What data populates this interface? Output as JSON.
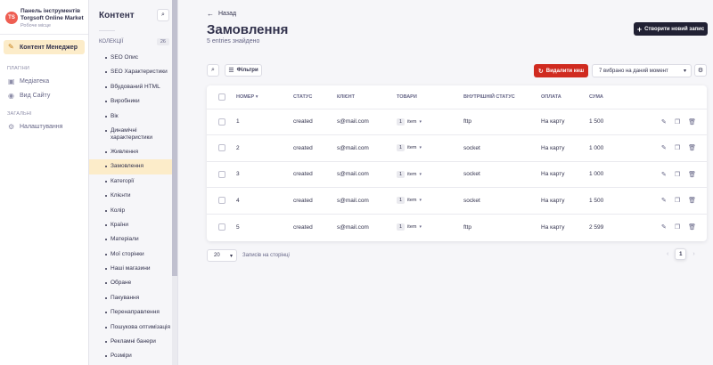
{
  "brand": {
    "title_line1": "Панель інструментів",
    "title_line2": "Torgsoft Online Market",
    "subtitle": "Робоче місце",
    "logo_text": "TS"
  },
  "mainnav": {
    "active_item": "Контент Менеджер",
    "plugins_label": "ПЛАГІНИ",
    "plugins": [
      "Медіатека",
      "Вид Сайту"
    ],
    "general_label": "ЗАГАЛЬНІ",
    "general": [
      "Налаштування"
    ]
  },
  "subnav": {
    "title": "Контент",
    "collections_label": "КОЛЕКЦІЇ",
    "collections_count": "26",
    "items": [
      "SEO Опис",
      "SEO Характеристики",
      "Вбудований HTML",
      "Виробники",
      "Вік",
      "Динамічні характеристики",
      "Живлення",
      "Замовлення",
      "Категорії",
      "Клієнти",
      "Колір",
      "Країни",
      "Матеріали",
      "Мої сторінки",
      "Наші магазини",
      "Обране",
      "Пакування",
      "Перенаправлення",
      "Пошукова оптимізація",
      "Рекламні банери",
      "Розміри"
    ],
    "active_index": 7
  },
  "header": {
    "back_label": "Назад",
    "title": "Замовлення",
    "subtitle": "5 entries знайдено",
    "create_button": "Створити новий запис"
  },
  "toolbar": {
    "filter_label": "Фільтри",
    "delete_cache_label": "Видалити кеш",
    "locale_select_value": "7 вибрано на даний момент"
  },
  "table": {
    "columns": [
      "НОМЕР",
      "СТАТУС",
      "КЛІЄНТ",
      "ТОВАРИ",
      "ВНУТРІШНІЙ СТАТУС",
      "ОПЛАТА",
      "СУМА"
    ],
    "rows": [
      {
        "number": "1",
        "status": "created",
        "client": "s@mail.com",
        "items_count": "1",
        "items_label": "item",
        "internal_status": "fttp",
        "payment": "На карту",
        "sum": "1 500"
      },
      {
        "number": "2",
        "status": "created",
        "client": "s@mail.com",
        "items_count": "1",
        "items_label": "item",
        "internal_status": "socket",
        "payment": "На карту",
        "sum": "1 000"
      },
      {
        "number": "3",
        "status": "created",
        "client": "s@mail.com",
        "items_count": "1",
        "items_label": "item",
        "internal_status": "socket",
        "payment": "На карту",
        "sum": "1 000"
      },
      {
        "number": "4",
        "status": "created",
        "client": "s@mail.com",
        "items_count": "1",
        "items_label": "item",
        "internal_status": "socket",
        "payment": "На карту",
        "sum": "1 500"
      },
      {
        "number": "5",
        "status": "created",
        "client": "s@mail.com",
        "items_count": "1",
        "items_label": "item",
        "internal_status": "fttp",
        "payment": "На карту",
        "sum": "2 599"
      }
    ]
  },
  "footer": {
    "page_size": "20",
    "page_size_label": "Записів на сторінці",
    "current_page": "1"
  },
  "icons": {
    "content_manager": "feather-pen-icon",
    "media": "image-icon",
    "site": "eye-icon",
    "settings": "gear-icon"
  },
  "colors": {
    "accent": "#c47a0f",
    "active_bg": "#fcecc9",
    "danger": "#d02b20",
    "primary_dark": "#212134",
    "logo": "#ee5e52"
  }
}
